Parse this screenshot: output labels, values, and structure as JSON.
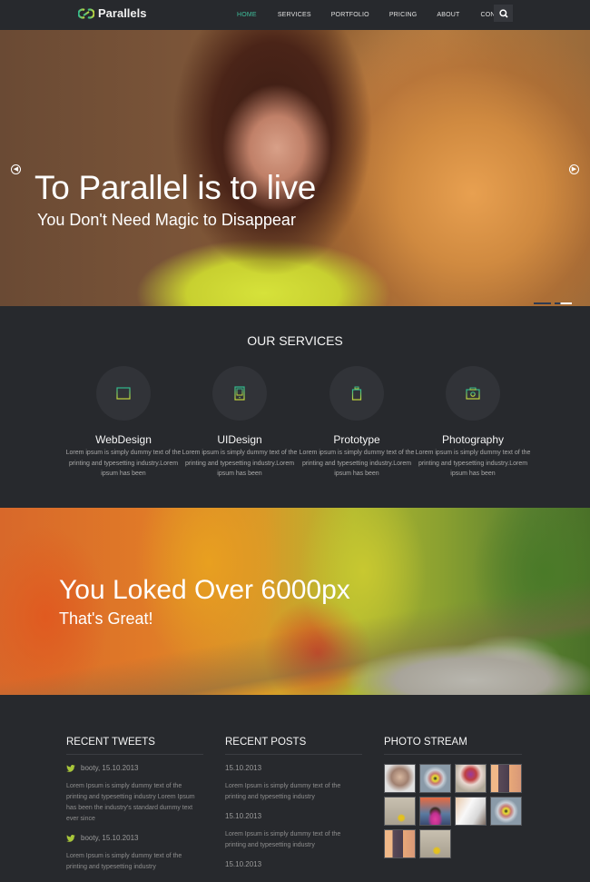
{
  "nav": {
    "brand": "Parallels",
    "items": [
      {
        "label": "HOME",
        "active": true
      },
      {
        "label": "SERVICES",
        "active": false
      },
      {
        "label": "PORTFOLIO",
        "active": false
      },
      {
        "label": "PRICING",
        "active": false
      },
      {
        "label": "ABOUT",
        "active": false
      },
      {
        "label": "CONTACT",
        "active": false
      }
    ],
    "search_icon": "search-icon"
  },
  "hero": {
    "title": "To Parallel is to live",
    "subtitle": "You Don't Need Magic to Disappear",
    "prev_icon": "arrow-left-circle-icon",
    "next_icon": "arrow-right-circle-icon",
    "slides_count": 2,
    "active_slide": 2
  },
  "services": {
    "title": "OUR SERVICES",
    "items": [
      {
        "icon": "browser-window-icon",
        "title": "WebDesign",
        "text": "Lorem ipsum is simply dummy text of the printing and typesetting industry.Lorem ipsum has been"
      },
      {
        "icon": "mobile-device-icon",
        "title": "UIDesign",
        "text": "Lorem ipsum is simply dummy text of the printing and typesetting industry.Lorem ipsum has been"
      },
      {
        "icon": "trash-bin-icon",
        "title": "Prototype",
        "text": "Lorem ipsum is simply dummy text of the printing and typesetting industry.Lorem ipsum has been"
      },
      {
        "icon": "camera-icon",
        "title": "Photography",
        "text": "Lorem ipsum is simply dummy text of the printing and typesetting industry.Lorem ipsum has been"
      }
    ]
  },
  "banner": {
    "title": "You Loked Over 6000px",
    "subtitle": "That's Great!"
  },
  "footer": {
    "tweets": {
      "title": "RECENT TWEETS",
      "items": [
        {
          "meta": "booty, 15.10.2013",
          "text": "Lorem Ipsum is simply dummy text of the printing and typesetting industry Lorem Ipsum has been the industry's standard dummy text ever since"
        },
        {
          "meta": "booty, 15.10.2013",
          "text": "Lorem Ipsum is simply dummy text of the printing and typesetting industry"
        }
      ]
    },
    "posts": {
      "title": "RECENT POSTS",
      "items": [
        {
          "date": "15.10.2013",
          "text": "Lorem Ipsum is simply dummy text of the printing and typesetting industry"
        },
        {
          "date": "15.10.2013",
          "text": "Lorem Ipsum is simply dummy text of the printing and typesetting industry"
        },
        {
          "date": "15.10.2013",
          "text": ""
        }
      ]
    },
    "photos": {
      "title": "PHOTO STREAM",
      "items": [
        {
          "subject": "surprised-man"
        },
        {
          "subject": "target-figure"
        },
        {
          "subject": "clown"
        },
        {
          "subject": "tower-sunset"
        },
        {
          "subject": "umbrella-figure"
        },
        {
          "subject": "girl-braids"
        },
        {
          "subject": "woman-white-shirt"
        },
        {
          "subject": "target-figure"
        },
        {
          "subject": "tower-sunset"
        },
        {
          "subject": "umbrella-figure"
        }
      ]
    }
  },
  "colors": {
    "background": "#27292d",
    "accent_green": "#3fbf9c",
    "accent_lime": "#a8c63a",
    "circle_bg": "#313338",
    "muted_text": "#8e8e8e"
  }
}
